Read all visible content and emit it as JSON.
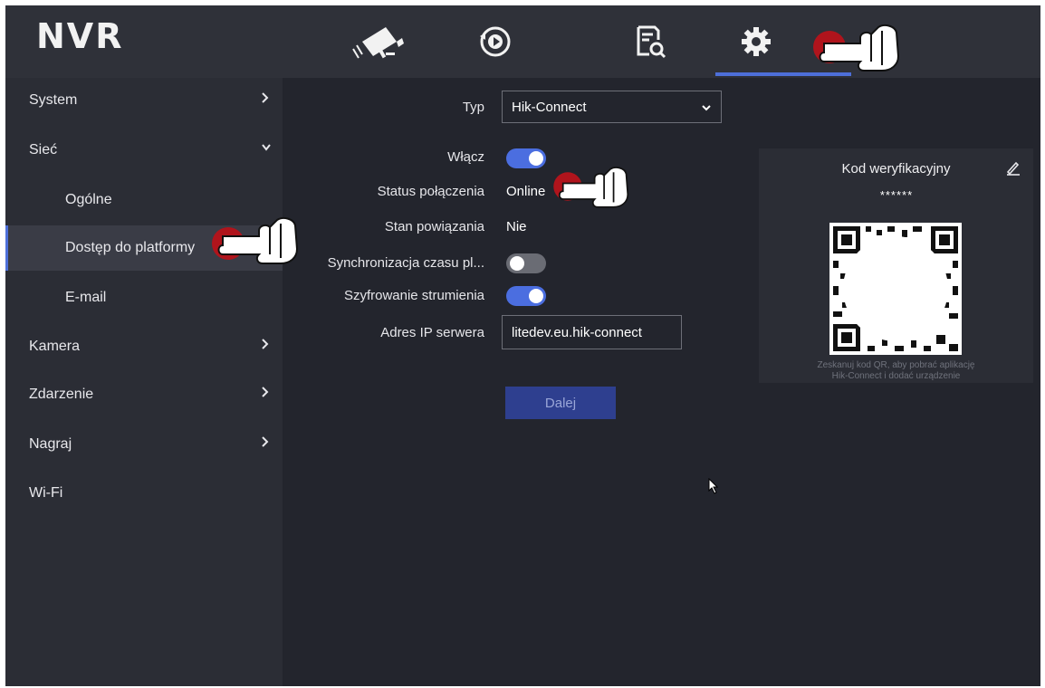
{
  "header": {
    "logo": "NVR",
    "tabs": [
      {
        "icon": "camera-icon",
        "active": false
      },
      {
        "icon": "playback-icon",
        "active": false
      },
      {
        "icon": "file-search-icon",
        "active": false
      },
      {
        "icon": "gear-icon",
        "active": true
      }
    ],
    "accent_color": "#4d6fd9"
  },
  "sidebar": {
    "items": [
      {
        "label": "System",
        "chevron": "right"
      },
      {
        "label": "Sieć",
        "chevron": "down"
      },
      {
        "label": "Ogólne",
        "sub": true
      },
      {
        "label": "Dostęp do platformy",
        "sub": true,
        "active": true
      },
      {
        "label": "E-mail",
        "sub": true
      },
      {
        "label": "Kamera",
        "chevron": "right"
      },
      {
        "label": "Zdarzenie",
        "chevron": "right"
      },
      {
        "label": "Nagraj",
        "chevron": "right"
      },
      {
        "label": "Wi-Fi"
      }
    ]
  },
  "form": {
    "type_label": "Typ",
    "type_value": "Hik-Connect",
    "enable_label": "Włącz",
    "enable_on": true,
    "status_label": "Status połączenia",
    "status_value": "Online",
    "binding_label": "Stan powiązania",
    "binding_value": "Nie",
    "timesync_label": "Synchronizacja czasu pl...",
    "timesync_on": false,
    "encryption_label": "Szyfrowanie strumienia",
    "encryption_on": true,
    "server_label": "Adres IP serwera",
    "server_value": "litedev.eu.hik-connect",
    "next_button": "Dalej"
  },
  "qr_panel": {
    "title": "Kod weryfikacyjny",
    "code": "******",
    "hint_line1": "Zeskanuj kod QR, aby pobrać aplikację",
    "hint_line2": "Hik-Connect i dodać urządzenie"
  }
}
